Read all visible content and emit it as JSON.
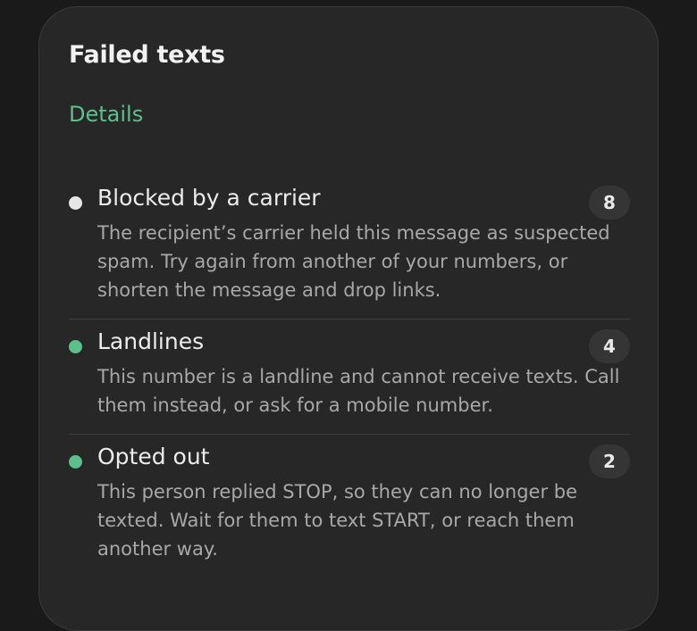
{
  "panel": {
    "title": "Failed texts",
    "details_label": "Details"
  },
  "items": [
    {
      "title": "Blocked by a carrier",
      "description": "The recipient’s carrier held this message as suspected spam. Try again from another of your numbers, or shorten the message and drop links.",
      "count": "8",
      "dot_color": "#e6e6e6"
    },
    {
      "title": "Landlines",
      "description": "This number is a landline and cannot receive texts. Call them instead, or ask for a mobile number.",
      "count": "4",
      "dot_color": "#5cc08a"
    },
    {
      "title": "Opted out",
      "description": "This person replied STOP, so they can no longer be texted. Wait for them to text START, or reach them another way.",
      "count": "2",
      "dot_color": "#5cc08a"
    }
  ]
}
